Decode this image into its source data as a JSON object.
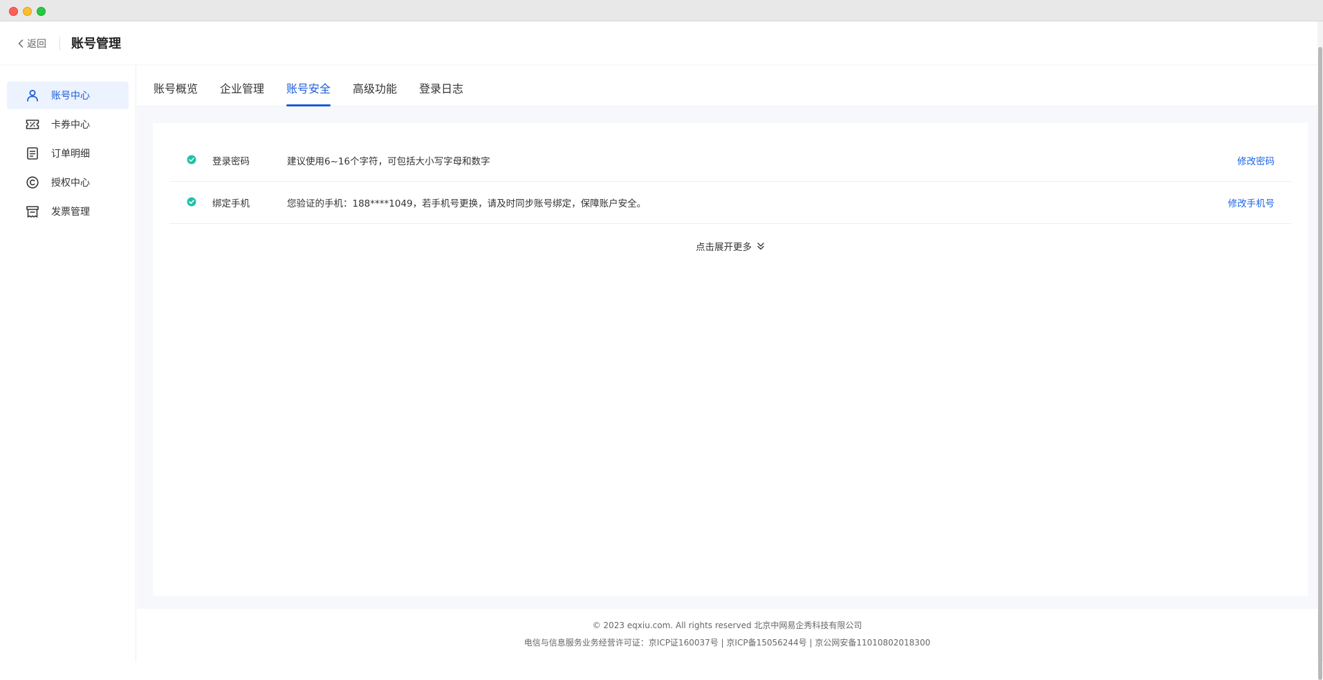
{
  "header": {
    "back_label": "返回",
    "title": "账号管理"
  },
  "sidebar": {
    "items": [
      {
        "label": "账号中心",
        "icon": "user-icon",
        "active": true
      },
      {
        "label": "卡券中心",
        "icon": "coupon-icon",
        "active": false
      },
      {
        "label": "订单明细",
        "icon": "order-icon",
        "active": false
      },
      {
        "label": "授权中心",
        "icon": "copyright-icon",
        "active": false
      },
      {
        "label": "发票管理",
        "icon": "invoice-icon",
        "active": false
      }
    ]
  },
  "tabs": [
    {
      "label": "账号概览",
      "active": false
    },
    {
      "label": "企业管理",
      "active": false
    },
    {
      "label": "账号安全",
      "active": true
    },
    {
      "label": "高级功能",
      "active": false
    },
    {
      "label": "登录日志",
      "active": false
    }
  ],
  "security": {
    "rows": [
      {
        "label": "登录密码",
        "description": "建议使用6~16个字符，可包括大小写字母和数字",
        "action": "修改密码",
        "status_icon": "check-circle-icon"
      },
      {
        "label": "绑定手机",
        "description": "您验证的手机：188****1049，若手机号更换，请及时同步账号绑定，保障账户安全。",
        "action": "修改手机号",
        "status_icon": "check-circle-icon"
      }
    ],
    "expand_label": "点击展开更多"
  },
  "footer": {
    "copyright": "© 2023 eqxiu.com. All rights reserved 北京中网易企秀科技有限公司",
    "license": "电信与信息服务业务经营许可证：京ICP证160037号 | 京ICP备15056244号 | 京公网安备11010802018300"
  },
  "colors": {
    "accent": "#1a5cd9",
    "link": "#1a66e6",
    "success": "#1fc2a6",
    "active_bg": "#ecf3ff"
  }
}
